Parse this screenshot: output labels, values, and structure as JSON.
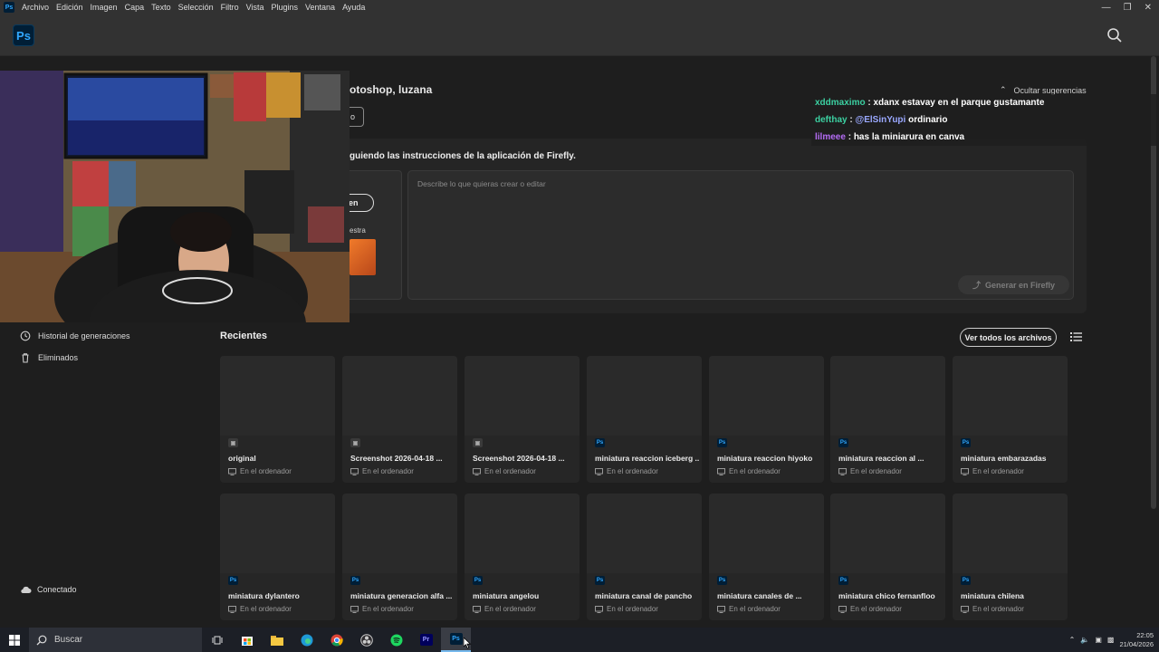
{
  "menubar": {
    "items": [
      "Archivo",
      "Edición",
      "Imagen",
      "Capa",
      "Texto",
      "Selección",
      "Filtro",
      "Vista",
      "Plugins",
      "Ventana",
      "Ayuda"
    ]
  },
  "app": {
    "logo_text": "Ps"
  },
  "home": {
    "greeting": "otoshop, luzana",
    "hide_suggestions": "Ocultar sugerencias",
    "small_btn": "o",
    "firefly_title": "guiendo las instrucciones de la aplicación de Firefly.",
    "pill_label": "en",
    "sample_label": "estra",
    "prompt_placeholder": "Describe lo que quieras crear o editar",
    "generate_label": "Generar en Firefly"
  },
  "chat": [
    {
      "user": "xddmaximo",
      "user_color": "#3cd1a2",
      "text": "xdanx estavay en el parque gustamante"
    },
    {
      "user": "defthay",
      "user_color": "#3cd1a2",
      "mention": "@ElSinYupi",
      "text": " ordinario"
    },
    {
      "user": "lilmeee",
      "user_color": "#b46cf5",
      "text": "has la miniarura en canva"
    }
  ],
  "sidebar": {
    "history": "Historial de generaciones",
    "deleted": "Eliminados",
    "connected": "Conectado"
  },
  "recents": {
    "title": "Recientes",
    "view_all": "Ver todos los archivos",
    "location": "En el ordenador",
    "files": [
      {
        "name": "original",
        "type": "img"
      },
      {
        "name": "Screenshot 2026-04-18 ...",
        "type": "img"
      },
      {
        "name": "Screenshot 2026-04-18 ...",
        "type": "img"
      },
      {
        "name": "miniatura reaccion iceberg ...",
        "type": "ps"
      },
      {
        "name": "miniatura reaccion hiyoko",
        "type": "ps"
      },
      {
        "name": "miniatura reaccion al ...",
        "type": "ps"
      },
      {
        "name": "miniatura embarazadas",
        "type": "ps"
      },
      {
        "name": "miniatura dylantero",
        "type": "ps"
      },
      {
        "name": "miniatura generacion alfa ...",
        "type": "ps"
      },
      {
        "name": "miniatura angelou",
        "type": "ps"
      },
      {
        "name": "miniatura canal de pancho",
        "type": "ps"
      },
      {
        "name": "miniatura canales de ...",
        "type": "ps"
      },
      {
        "name": "miniatura chico fernanfloo",
        "type": "ps"
      },
      {
        "name": "miniatura chilena",
        "type": "ps"
      }
    ]
  },
  "taskbar": {
    "search": "Buscar",
    "apps": [
      "task-view",
      "store",
      "explorer",
      "edge",
      "chrome",
      "obs",
      "spotify",
      "Pr",
      "Ps"
    ],
    "time": "22:05",
    "date": "21/04/2026"
  }
}
